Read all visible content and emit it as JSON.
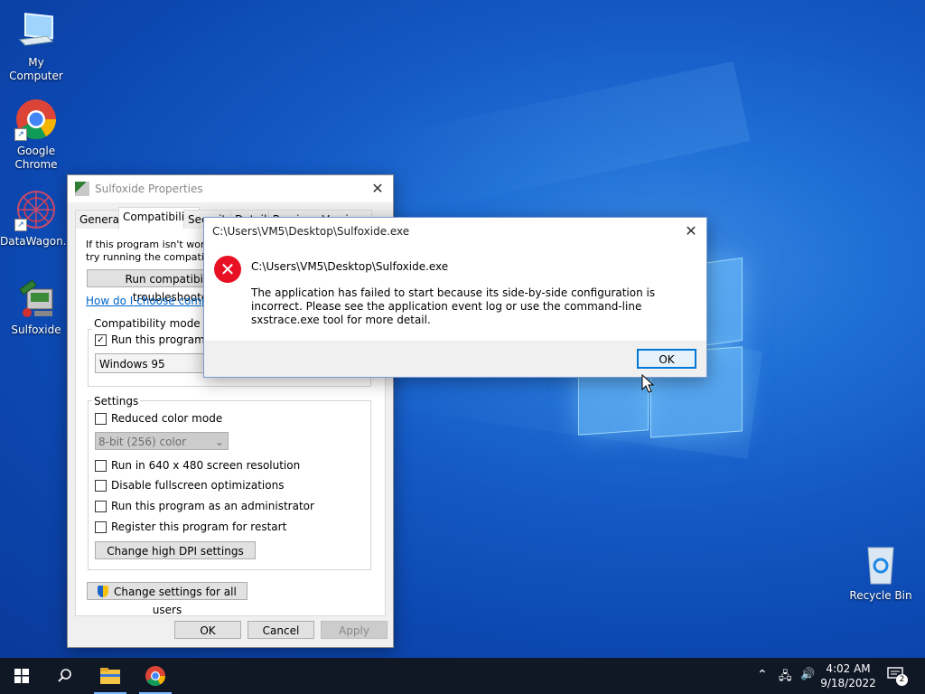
{
  "desktop": {
    "icons": [
      {
        "label": "My Computer"
      },
      {
        "label": "Google Chrome"
      },
      {
        "label": "DataWagon..."
      },
      {
        "label": "Sulfoxide"
      },
      {
        "label": "Recycle Bin"
      }
    ]
  },
  "properties_window": {
    "title": "Sulfoxide Properties",
    "tabs": [
      "General",
      "Compatibility",
      "Security",
      "Details",
      "Previous Versions"
    ],
    "intro_line1": "If this program isn't working",
    "intro_line2": "try running the compatibility",
    "troubleshooter_button": "Run compatibility troubleshooter",
    "help_link": "How do I choose compatibility settings manually?",
    "compat_mode_group": "Compatibility mode",
    "compat_mode_checkbox": "Run this program in compatibility mode for:",
    "compat_mode_select": "Windows 95",
    "settings_group": "Settings",
    "reduced_color": "Reduced color mode",
    "color_select": "8-bit (256) color",
    "run_640": "Run in 640 x 480 screen resolution",
    "disable_fullscreen": "Disable fullscreen optimizations",
    "run_admin": "Run this program as an administrator",
    "register_restart": "Register this program for restart",
    "dpi_button": "Change high DPI settings",
    "all_users_button": "Change settings for all users",
    "ok": "OK",
    "cancel": "Cancel",
    "apply": "Apply"
  },
  "error_dialog": {
    "title": "C:\\Users\\VM5\\Desktop\\Sulfoxide.exe",
    "heading": "C:\\Users\\VM5\\Desktop\\Sulfoxide.exe",
    "message": "The application has failed to start because its side-by-side configuration is incorrect. Please see the application event log or use the command-line sxstrace.exe tool for more detail.",
    "ok": "OK"
  },
  "taskbar": {
    "time": "4:02 AM",
    "date": "9/18/2022",
    "notification_count": "2"
  },
  "colors": {
    "accent": "#0078d7",
    "error_red": "#e81123",
    "link": "#0066cc"
  }
}
